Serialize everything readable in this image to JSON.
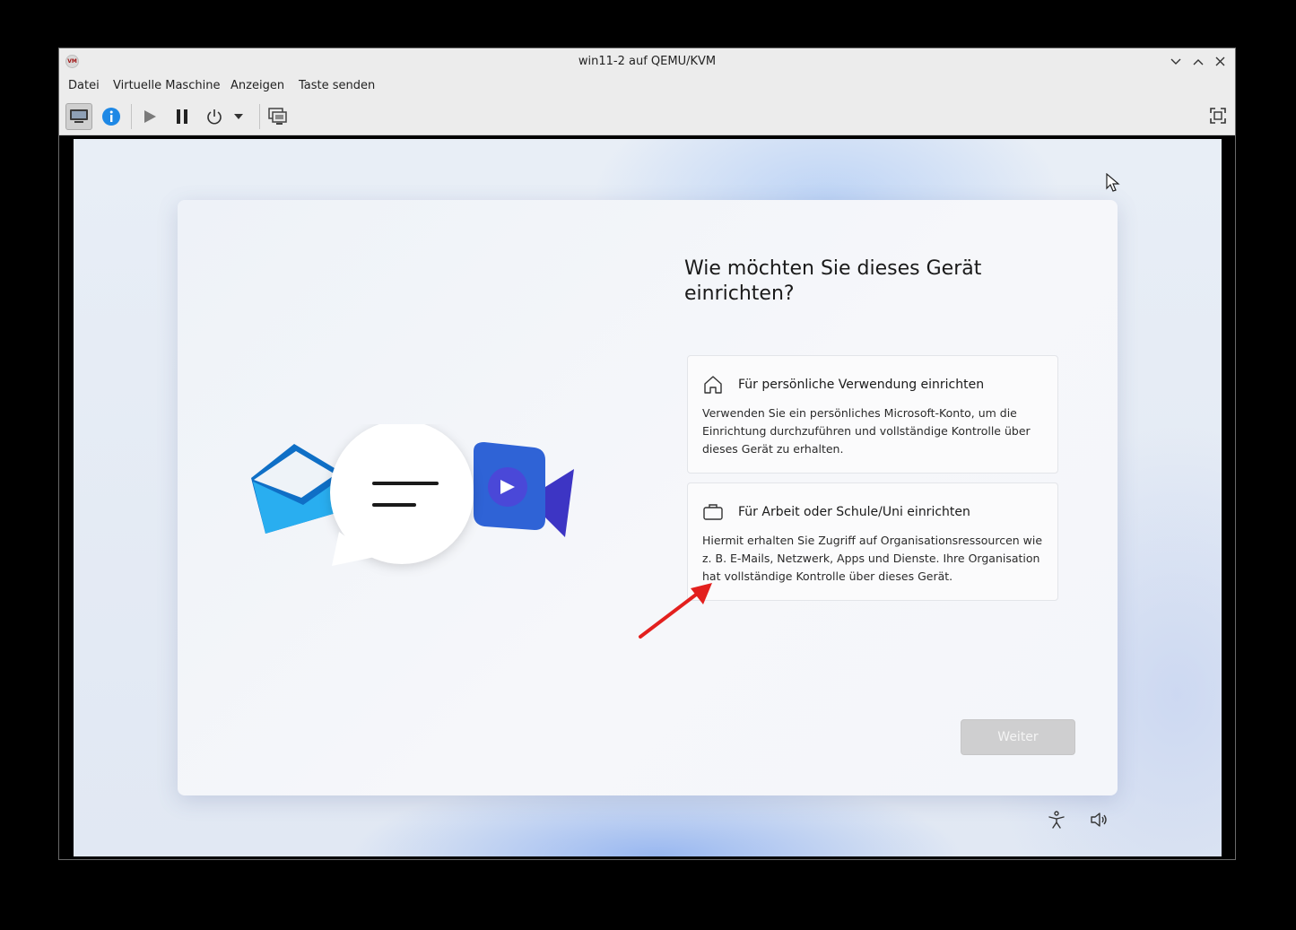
{
  "window": {
    "title": "win11-2 auf QEMU/KVM",
    "app_icon_text": "VM"
  },
  "menubar": {
    "items": [
      "Datei",
      "Virtuelle Maschine",
      "Anzeigen",
      "Taste senden"
    ]
  },
  "toolbar": {
    "icons": [
      "monitor-icon",
      "info-icon",
      "play-icon",
      "pause-icon",
      "power-icon",
      "dropdown-icon",
      "snapshot-icon",
      "fullscreen-icon"
    ]
  },
  "setup": {
    "heading": "Wie möchten Sie dieses Gerät einrichten?",
    "options": [
      {
        "icon": "home-icon",
        "title": "Für persönliche Verwendung einrichten",
        "description": "Verwenden Sie ein persönliches Microsoft-Konto, um die Einrichtung durchzuführen und vollständige Kontrolle über dieses Gerät zu erhalten."
      },
      {
        "icon": "briefcase-icon",
        "title": "Für Arbeit oder Schule/Uni einrichten",
        "description": "Hiermit erhalten Sie Zugriff auf Organisationsressourcen wie z. B. E-Mails, Netzwerk, Apps und Dienste. Ihre Organisation hat vollständige Kontrolle über dieses Gerät."
      }
    ],
    "next_button": "Weiter"
  },
  "colors": {
    "accent_info": "#1e88e5",
    "annotation_arrow": "#e3201e",
    "mail_blue": "#1fa3e8",
    "video_blue": "#3b4fd8"
  }
}
